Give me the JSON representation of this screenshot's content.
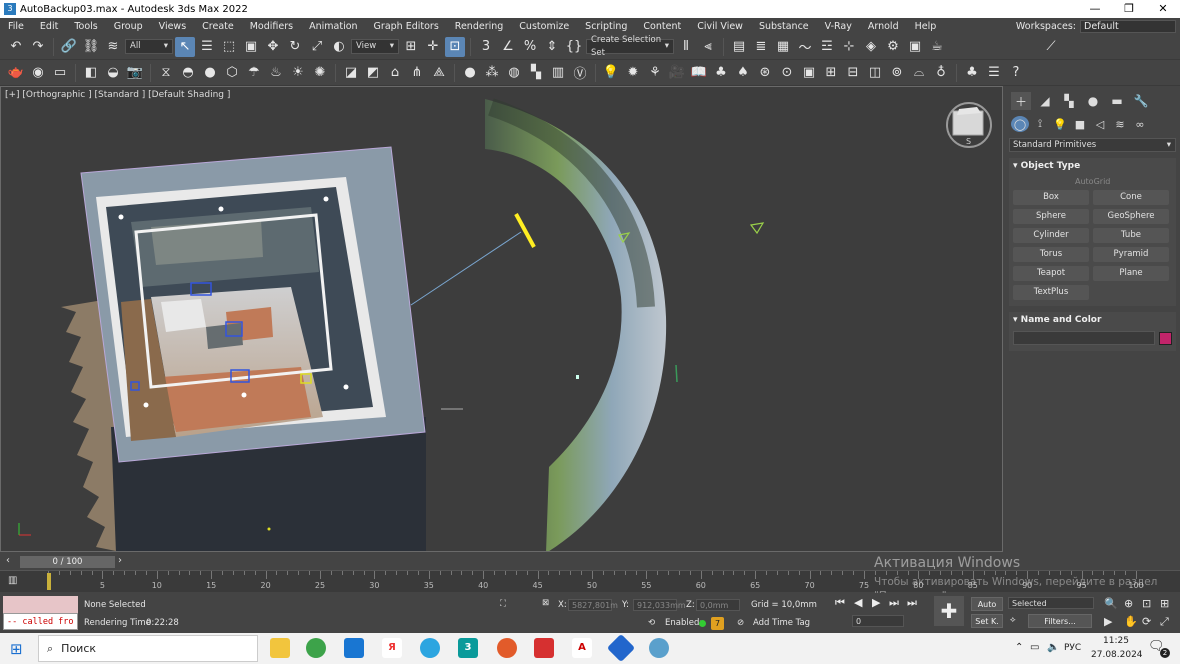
{
  "window": {
    "title": "AutoBackup03.max - Autodesk 3ds Max 2022",
    "app_icon": "3"
  },
  "menu": [
    "File",
    "Edit",
    "Tools",
    "Group",
    "Views",
    "Create",
    "Modifiers",
    "Animation",
    "Graph Editors",
    "Rendering",
    "Customize",
    "Scripting",
    "Content",
    "Civil View",
    "Substance",
    "V-Ray",
    "Arnold",
    "Help"
  ],
  "workspaces": {
    "label": "Workspaces:",
    "value": "Default"
  },
  "toolbar1": {
    "filter": "All",
    "refcoord": "View",
    "selection_set": "Create Selection Set"
  },
  "viewport": {
    "label": "[+] [Orthographic ] [Standard ] [Default Shading ]",
    "viewcube_s": "S"
  },
  "command_panel": {
    "category": "Standard Primitives",
    "object_type_title": "Object Type",
    "autogrid": "AutoGrid",
    "primitives": [
      "Box",
      "Cone",
      "Sphere",
      "GeoSphere",
      "Cylinder",
      "Tube",
      "Torus",
      "Pyramid",
      "Teapot",
      "Plane",
      "TextPlus"
    ],
    "name_color_title": "Name and Color",
    "color": "#c2246a"
  },
  "time_slider": {
    "value": "0 / 100"
  },
  "track_labels": [
    "0",
    "5",
    "10",
    "15",
    "20",
    "25",
    "30",
    "35",
    "40",
    "45",
    "50",
    "55",
    "60",
    "65",
    "70",
    "75",
    "80",
    "85",
    "90",
    "95",
    "100"
  ],
  "status": {
    "maxscript_line": "-- called fro",
    "selection": "None Selected",
    "render_time_label": "Rendering Time",
    "render_time": "0:22:28",
    "x_label": "X:",
    "x_value": "5827,801m",
    "y_label": "Y:",
    "y_value": "912,033mm",
    "z_label": "Z:",
    "z_value": "0,0mm",
    "grid": "Grid = 10,0mm",
    "enabled_label": "Enabled:",
    "add_time_tag": "Add Time Tag",
    "auto_key": "Auto",
    "set_key": "Set K.",
    "key_filter": "Selected",
    "filters": "Filters...",
    "frame_value": "0"
  },
  "activation": {
    "line1": "Активация Windows",
    "line2": "Чтобы активировать Windows, перейдите в раздел \"Параметры\"."
  },
  "taskbar": {
    "search": "Поиск",
    "lang": "РУС",
    "time": "11:25",
    "date": "27.08.2024",
    "notification_count": "2"
  }
}
